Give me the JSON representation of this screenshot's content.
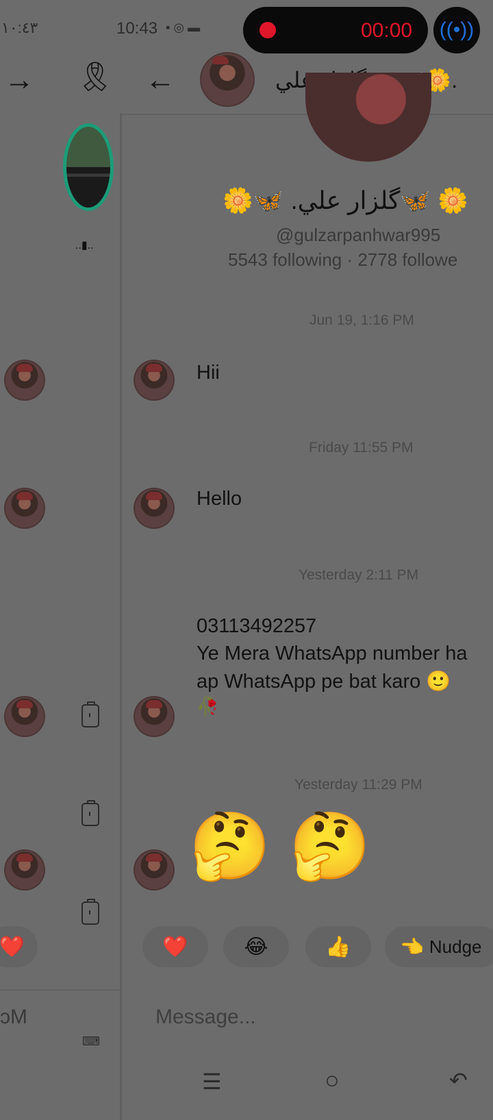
{
  "status_bar": {
    "left_clock": "١٠:٤٣",
    "time": "10:43",
    "recording_time": "00:00"
  },
  "header": {
    "title": "گلزار علي.... 🦋🌼.",
    "back_arrow": "←",
    "forward_arrow": "→"
  },
  "profile": {
    "display_name": "🌼🦋 .گلزار علي🦋 🌼",
    "username": "@gulzarpanhwar995",
    "stats": "5543 following · 2778 followe"
  },
  "left_panel": {
    "caption": "..▮..",
    "input_fragment": "ɔM"
  },
  "messages": [
    {
      "timestamp": "Jun 19, 1:16 PM",
      "text": "Hii"
    },
    {
      "timestamp": "Friday 11:55 PM",
      "text": "Hello"
    },
    {
      "timestamp": "Yesterday 2:11 PM",
      "line1": "03113492257",
      "line2": "Ye Mera WhatsApp number ha",
      "line3": "ap WhatsApp pe bat karo 🙂",
      "line4": "🥀"
    },
    {
      "timestamp": "Yesterday 11:29 PM",
      "text": "🤔 🤔"
    }
  ],
  "reactions": {
    "heart": "❤️",
    "laugh": "😂",
    "thumbs": "👍",
    "nudge": "Nudge",
    "nudge_icon": "👈"
  },
  "composer": {
    "placeholder": "Message..."
  },
  "nav": {
    "menu": "☰",
    "home": "○",
    "back": "↶"
  },
  "colors": {
    "record_red": "#e0162b",
    "record_bg": "#0a0a0a",
    "accent_blue": "#1e6fd9",
    "overlay_gray": "#6c6c6c"
  }
}
